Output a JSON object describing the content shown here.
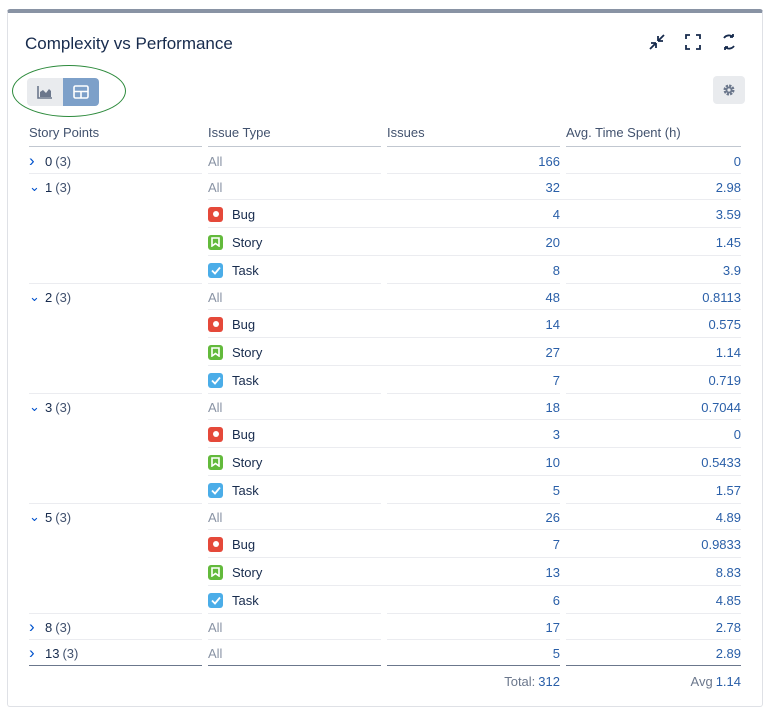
{
  "title": "Complexity vs Performance",
  "columns": {
    "story_points": "Story Points",
    "issue_type": "Issue Type",
    "issues": "Issues",
    "avg_time": "Avg. Time Spent (h)"
  },
  "groups": [
    {
      "sp": "0",
      "count": "(3)",
      "expanded": false,
      "all_label": "All",
      "issues": "166",
      "avg": "0",
      "rows": []
    },
    {
      "sp": "1",
      "count": "(3)",
      "expanded": true,
      "all_label": "All",
      "issues": "32",
      "avg": "2.98",
      "rows": [
        {
          "type": "Bug",
          "icon": "bug-icon",
          "issues": "4",
          "avg": "3.59"
        },
        {
          "type": "Story",
          "icon": "story-icon",
          "issues": "20",
          "avg": "1.45"
        },
        {
          "type": "Task",
          "icon": "task-icon",
          "issues": "8",
          "avg": "3.9"
        }
      ]
    },
    {
      "sp": "2",
      "count": "(3)",
      "expanded": true,
      "all_label": "All",
      "issues": "48",
      "avg": "0.8113",
      "rows": [
        {
          "type": "Bug",
          "icon": "bug-icon",
          "issues": "14",
          "avg": "0.575"
        },
        {
          "type": "Story",
          "icon": "story-icon",
          "issues": "27",
          "avg": "1.14"
        },
        {
          "type": "Task",
          "icon": "task-icon",
          "issues": "7",
          "avg": "0.719"
        }
      ]
    },
    {
      "sp": "3",
      "count": "(3)",
      "expanded": true,
      "all_label": "All",
      "issues": "18",
      "avg": "0.7044",
      "rows": [
        {
          "type": "Bug",
          "icon": "bug-icon",
          "issues": "3",
          "avg": "0"
        },
        {
          "type": "Story",
          "icon": "story-icon",
          "issues": "10",
          "avg": "0.5433"
        },
        {
          "type": "Task",
          "icon": "task-icon",
          "issues": "5",
          "avg": "1.57"
        }
      ]
    },
    {
      "sp": "5",
      "count": "(3)",
      "expanded": true,
      "all_label": "All",
      "issues": "26",
      "avg": "4.89",
      "rows": [
        {
          "type": "Bug",
          "icon": "bug-icon",
          "issues": "7",
          "avg": "0.9833"
        },
        {
          "type": "Story",
          "icon": "story-icon",
          "issues": "13",
          "avg": "8.83"
        },
        {
          "type": "Task",
          "icon": "task-icon",
          "issues": "6",
          "avg": "4.85"
        }
      ]
    },
    {
      "sp": "8",
      "count": "(3)",
      "expanded": false,
      "all_label": "All",
      "issues": "17",
      "avg": "2.78",
      "rows": []
    },
    {
      "sp": "13",
      "count": "(3)",
      "expanded": false,
      "all_label": "All",
      "issues": "5",
      "avg": "2.89",
      "rows": []
    }
  ],
  "footer": {
    "total_label": "Total:",
    "total_value": "312",
    "avg_label": "Avg",
    "avg_value": "1.14"
  },
  "colors": {
    "bug": "#e5493a",
    "story": "#63ba3c",
    "task": "#4bade8",
    "link": "#2a5fa8",
    "toggle_active": "#7da0c9",
    "highlight_ring": "#2e8b3d"
  },
  "icons": [
    "minimize-icon",
    "fullscreen-icon",
    "refresh-icon",
    "chart-view-icon",
    "table-view-icon",
    "gear-icon",
    "chevron-right-icon",
    "chevron-down-icon"
  ]
}
